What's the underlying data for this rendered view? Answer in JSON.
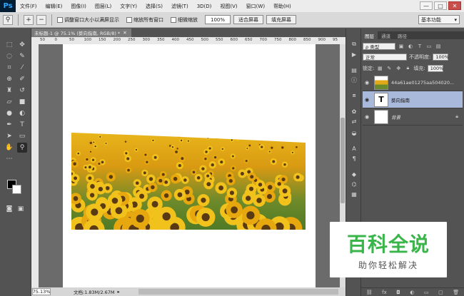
{
  "app": {
    "logo": "Ps"
  },
  "menu": [
    "文件(F)",
    "编辑(E)",
    "图像(I)",
    "图层(L)",
    "文字(Y)",
    "选择(S)",
    "滤镜(T)",
    "3D(D)",
    "视图(V)",
    "窗口(W)",
    "帮助(H)"
  ],
  "window_controls": {
    "minimize": "—",
    "maximize": "□",
    "close": "✕"
  },
  "options": {
    "check_resize": "调整窗口大小以满屏显示",
    "check_zoom_all": "缩放所有窗口",
    "check_scrubby": "细微缩放",
    "zoom_value": "100%",
    "fit_screen": "适合屏幕",
    "fill_screen": "填充屏幕",
    "workspace": "基本功能"
  },
  "document": {
    "tab_title": "未标题-1 @ 75.1% (葵向指南, RGB/8) *",
    "ruler_ticks": [
      "50",
      "0",
      "50",
      "100",
      "150",
      "200",
      "250",
      "300",
      "350",
      "400",
      "450",
      "500",
      "550",
      "600",
      "650",
      "700",
      "750",
      "800",
      "850",
      "900",
      "95"
    ]
  },
  "status": {
    "zoom": "75.13%",
    "doc_info": "文档:1.83M/2.67M"
  },
  "layers_panel": {
    "tabs": [
      "图层",
      "通道",
      "路径"
    ],
    "filter": "ρ 类型",
    "blend_mode": "正常",
    "opacity_label": "不透明度:",
    "opacity_value": "100%",
    "lock_label": "锁定:",
    "fill_label": "填充:",
    "fill_value": "100%",
    "layers": [
      {
        "name": "44a61ae01275aa504020...",
        "thumb": ""
      },
      {
        "name": "葵向指南",
        "thumb": "T"
      },
      {
        "name": "背景",
        "thumb": ""
      }
    ]
  },
  "watermark": {
    "main": "百科全说",
    "sub": "助你轻松解决"
  },
  "colors": {
    "selected_layer": "#a9b9dc",
    "watermark_green": "#39b54a"
  }
}
